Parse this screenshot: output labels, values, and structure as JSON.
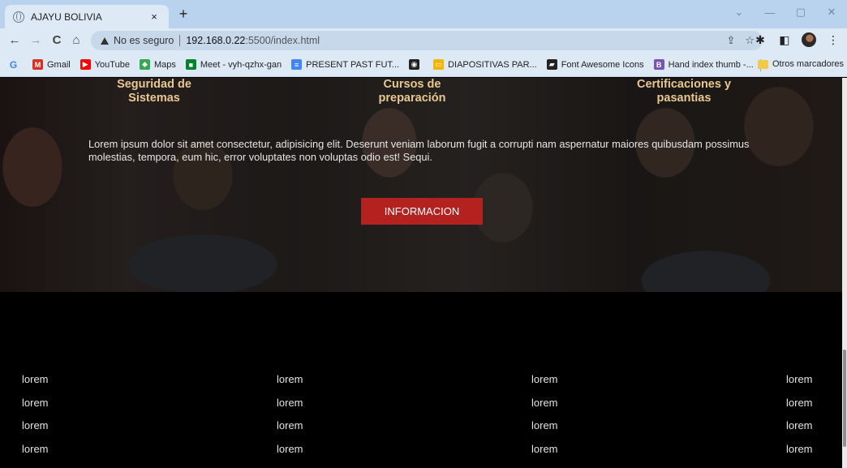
{
  "browser": {
    "tab_title": "AJAYU BOLIVIA",
    "tab_close": "×",
    "new_tab": "+",
    "security_label": "No es seguro",
    "url_host": "192.168.0.22",
    "url_path": ":5500/index.html",
    "bookmarks": [
      {
        "label": "Gmail",
        "icon": "gmail-icon",
        "color": "#d93025"
      },
      {
        "label": "YouTube",
        "icon": "youtube-icon",
        "color": "#ff0000"
      },
      {
        "label": "Maps",
        "icon": "maps-icon",
        "color": "#34a853"
      },
      {
        "label": "Meet - vyh-qzhx-gan",
        "icon": "meet-icon",
        "color": "#00832d"
      },
      {
        "label": "PRESENT PAST FUT...",
        "icon": "docs-icon",
        "color": "#4285f4"
      },
      {
        "label": "",
        "icon": "globe-icon",
        "color": "#222222"
      },
      {
        "label": "DIAPOSITIVAS PAR...",
        "icon": "slides-icon",
        "color": "#f4b400"
      },
      {
        "label": "Font Awesome Icons",
        "icon": "fontawesome-icon",
        "color": "#222222"
      },
      {
        "label": "Hand index thumb -...",
        "icon": "bootstrap-icon",
        "color": "#7952b3"
      }
    ],
    "other_bookmarks": "Otros marcadores"
  },
  "page": {
    "services": [
      "Seguridad de Sistemas",
      "Cursos de preparación",
      "Certificaciones y pasantias"
    ],
    "hero_text": "Lorem ipsum dolor sit amet consectetur, adipisicing elit. Deserunt veniam laborum fugit a corrupti nam aspernatur maiores quibusdam possimus molestias, tempora, eum hic, error voluptates non voluptas odio est! Sequi.",
    "info_button": "INFORMACION",
    "footer_columns": [
      [
        "lorem",
        "lorem",
        "lorem",
        "lorem"
      ],
      [
        "lorem",
        "lorem",
        "lorem",
        "lorem"
      ],
      [
        "lorem",
        "lorem",
        "lorem",
        "lorem"
      ],
      [
        "lorem",
        "lorem",
        "lorem",
        "lorem"
      ]
    ]
  },
  "colors": {
    "accent_button": "#b3221f",
    "service_title": "#e8c890",
    "chrome_bg": "#dde9f5"
  }
}
